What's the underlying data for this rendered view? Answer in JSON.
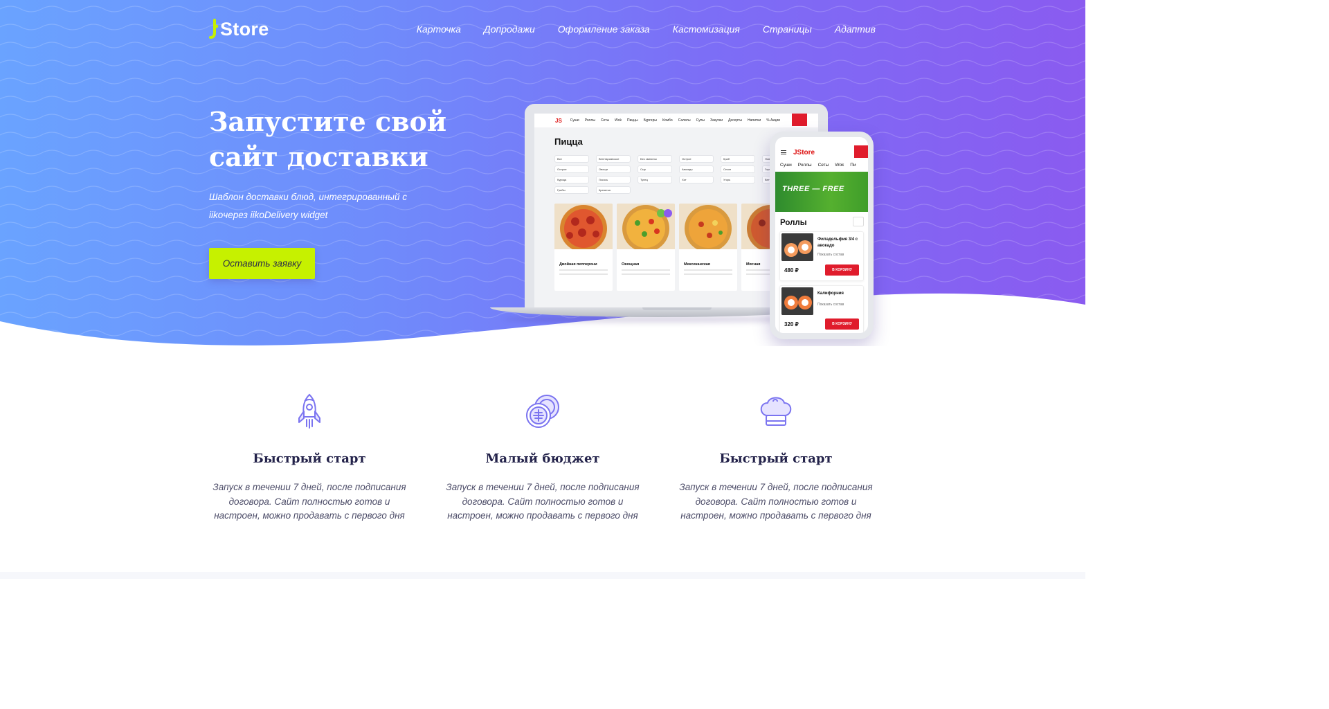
{
  "header": {
    "logo_text": "Store",
    "nav": [
      "Карточка",
      "Допродажи",
      "Оформление заказа",
      "Кастомизация",
      "Страницы",
      "Адаптив"
    ]
  },
  "hero": {
    "title_line1": "Запустите свой",
    "title_line2": "сайт доставки",
    "subtitle": "Шаблон доставки блюд, интегрированный с iikoчерез iikoDelivery widget",
    "cta_label": "Оставить заявку"
  },
  "mockup": {
    "laptop": {
      "brand": "JS",
      "menu": [
        "Суши",
        "Роллы",
        "Сеты",
        "Wok",
        "Пиццы",
        "Бургеры",
        "Комбо",
        "Салаты",
        "Супы",
        "Закуски",
        "Десерты",
        "Напитки",
        "% Акции"
      ],
      "page_title": "Пицца",
      "filters": [
        "Все",
        "Вегетарианское",
        "Без свинины",
        "Острое",
        "Краб",
        "Новинки",
        "Острое",
        "Овощи",
        "Сыр",
        "Авокадо",
        "Сезон",
        "Горячее",
        "Курица",
        "Лосось",
        "Тунец",
        "Хит",
        "Угорь",
        "Ветчина",
        "Грибы",
        "Креветка"
      ],
      "cards": [
        "Двойная пепперони",
        "Овощная",
        "Мексиканская",
        "Мясная"
      ]
    },
    "phone": {
      "brand": "JStore",
      "tabs": [
        "Суши",
        "Роллы",
        "Сеты",
        "Wok",
        "Пи"
      ],
      "banner": "THREE — FREE",
      "section": "Роллы",
      "items": [
        {
          "name": "Филадельфия 3/4 с авокадо",
          "link": "Показать состав",
          "price": "480 ₽",
          "button": "В КОРЗИНУ"
        },
        {
          "name": "Калифорния",
          "link": "Показать состав",
          "price": "320 ₽",
          "button": "В КОРЗИНУ"
        }
      ]
    }
  },
  "features": [
    {
      "icon": "rocket-icon",
      "title": "Быстрый старт",
      "text": "Запуск в течении 7 дней, после подписания договора. Сайт полностью готов и настроен, можно продавать с первого дня"
    },
    {
      "icon": "coins-icon",
      "title": "Малый бюджет",
      "text": "Запуск в течении 7 дней, после подписания договора. Сайт полностью готов и настроен, можно продавать с первого дня"
    },
    {
      "icon": "chef-hat-icon",
      "title": "Быстрый старт",
      "text": "Запуск в течении 7 дней, после подписания договора. Сайт полностью готов и настроен, можно продавать с первого дня"
    }
  ],
  "colors": {
    "accent": "#c6f100",
    "hero_gradient_start": "#6aa3ff",
    "hero_gradient_end": "#8a5bf0",
    "icon_stroke": "#7b74f0",
    "heading": "#23224a"
  }
}
